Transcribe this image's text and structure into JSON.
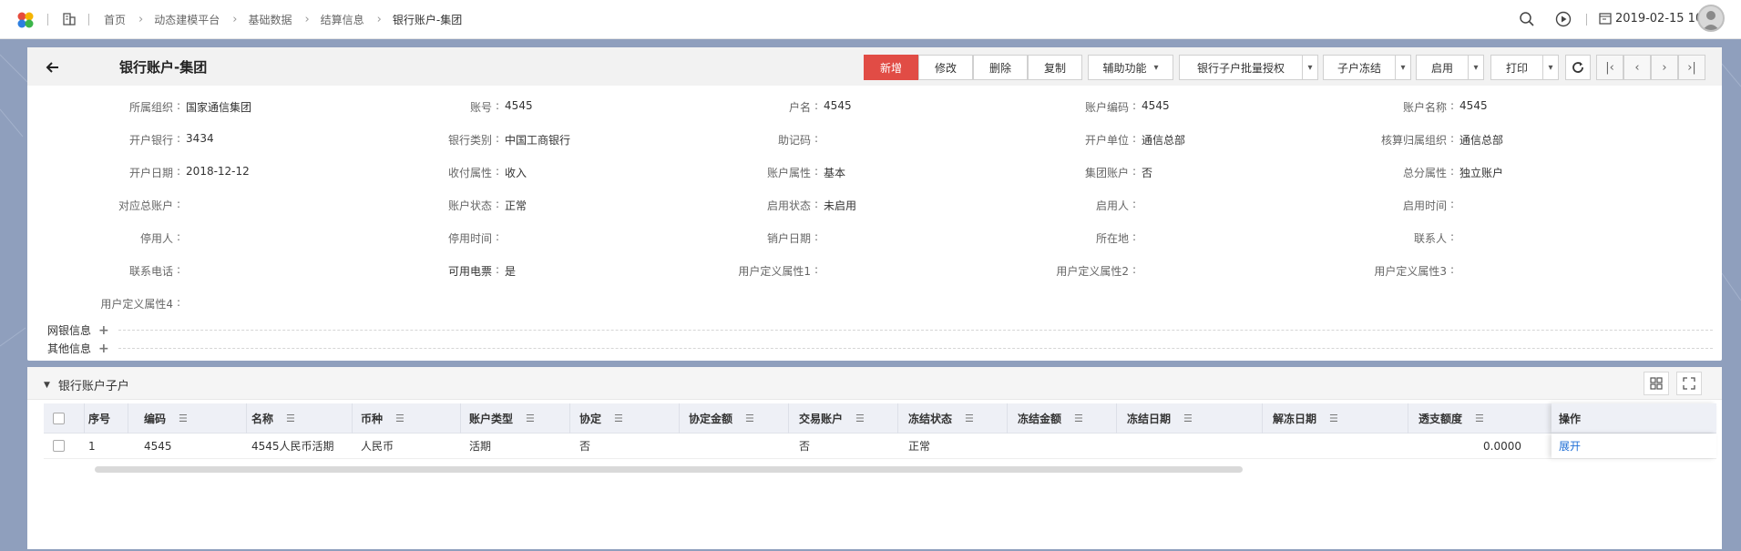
{
  "topbar": {
    "breadcrumb": [
      "首页",
      "动态建模平台",
      "基础数据",
      "结算信息",
      "银行账户-集团"
    ],
    "date_text": "2019-02-15 10"
  },
  "header": {
    "title": "银行账户-集团",
    "buttons": {
      "add": "新增",
      "edit": "修改",
      "delete": "删除",
      "copy": "复制",
      "assist": "辅助功能",
      "batch_auth": "银行子户批量授权",
      "freeze_sub": "子户冻结",
      "enable": "启用",
      "print": "打印"
    }
  },
  "form": {
    "rows": [
      [
        {
          "label": "所属组织",
          "value": "国家通信集团"
        },
        {
          "label": "账号",
          "value": "4545"
        },
        {
          "label": "户名",
          "value": "4545"
        },
        {
          "label": "账户编码",
          "value": "4545"
        },
        {
          "label": "账户名称",
          "value": "4545"
        }
      ],
      [
        {
          "label": "开户银行",
          "value": "3434"
        },
        {
          "label": "银行类别",
          "value": "中国工商银行"
        },
        {
          "label": "助记码",
          "value": ""
        },
        {
          "label": "开户单位",
          "value": "通信总部"
        },
        {
          "label": "核算归属组织",
          "value": "通信总部"
        }
      ],
      [
        {
          "label": "开户日期",
          "value": "2018-12-12"
        },
        {
          "label": "收付属性",
          "value": "收入"
        },
        {
          "label": "账户属性",
          "value": "基本"
        },
        {
          "label": "集团账户",
          "value": "否"
        },
        {
          "label": "总分属性",
          "value": "独立账户"
        }
      ],
      [
        {
          "label": "对应总账户",
          "value": ""
        },
        {
          "label": "账户状态",
          "value": "正常"
        },
        {
          "label": "启用状态",
          "value": "未启用"
        },
        {
          "label": "启用人",
          "value": ""
        },
        {
          "label": "启用时间",
          "value": ""
        }
      ],
      [
        {
          "label": "停用人",
          "value": ""
        },
        {
          "label": "停用时间",
          "value": ""
        },
        {
          "label": "销户日期",
          "value": ""
        },
        {
          "label": "所在地",
          "value": ""
        },
        {
          "label": "联系人",
          "value": ""
        }
      ],
      [
        {
          "label": "联系电话",
          "value": ""
        },
        {
          "label": "可用电票",
          "value": "是"
        },
        {
          "label": "用户定义属性1",
          "value": ""
        },
        {
          "label": "用户定义属性2",
          "value": ""
        },
        {
          "label": "用户定义属性3",
          "value": ""
        }
      ],
      [
        {
          "label": "用户定义属性4",
          "value": ""
        }
      ]
    ],
    "sections": [
      "网银信息",
      "其他信息"
    ]
  },
  "subtable": {
    "title": "银行账户子户",
    "columns": [
      "序号",
      "编码",
      "名称",
      "币种",
      "账户类型",
      "协定",
      "协定金额",
      "交易账户",
      "冻结状态",
      "冻结金额",
      "冻结日期",
      "解冻日期",
      "透支额度",
      "操作"
    ],
    "rows": [
      {
        "seq": "1",
        "code": "4545",
        "name": "4545人民币活期",
        "currency": "人民币",
        "acct_type": "活期",
        "agreement": "否",
        "agree_amount": "",
        "trade_acct": "否",
        "freeze_status": "正常",
        "freeze_amount": "",
        "freeze_date": "",
        "unfreeze_date": "",
        "overdraft": "0.0000",
        "op": "展开"
      }
    ]
  }
}
